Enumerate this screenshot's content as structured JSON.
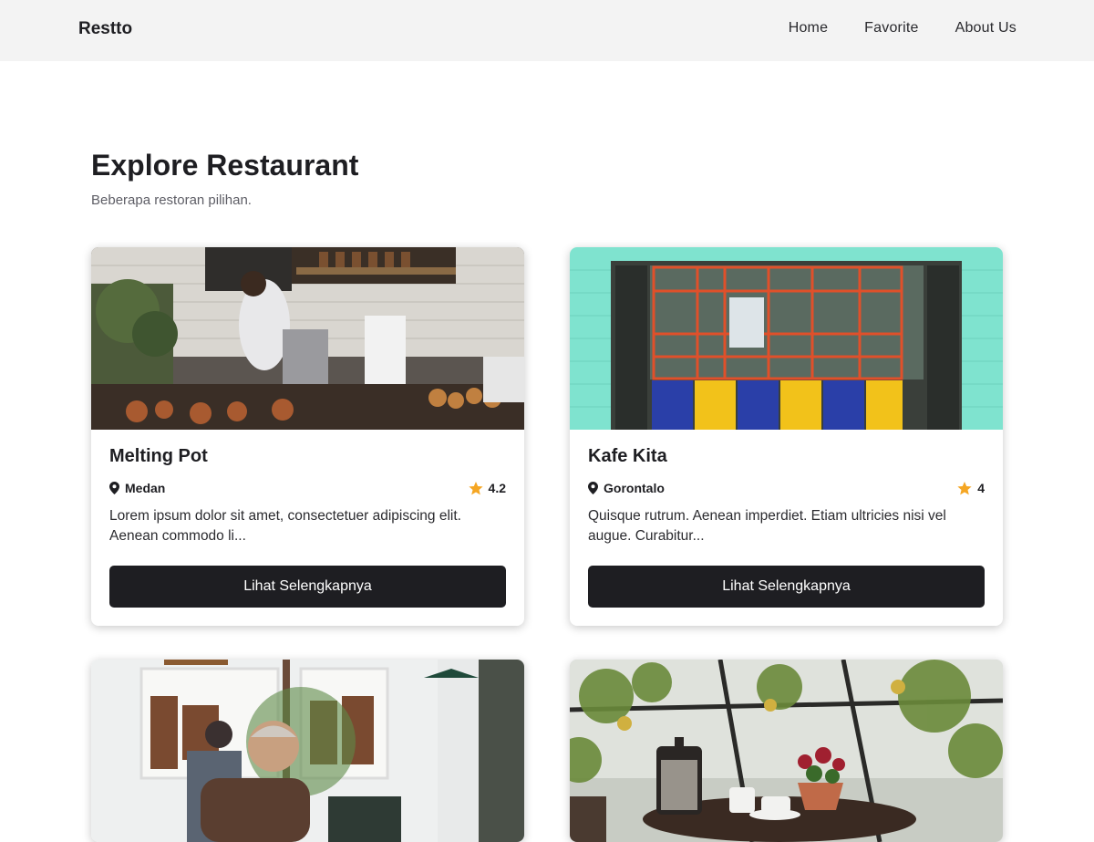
{
  "nav": {
    "brand": "Restto",
    "links": [
      "Home",
      "Favorite",
      "About Us"
    ]
  },
  "hero": {
    "title": "Explore Restaurant",
    "subtitle": "Beberapa restoran pilihan."
  },
  "colors": {
    "nav_bg": "#f3f3f3",
    "button_bg": "#1e1e22",
    "star": "#f5a623",
    "text": "#1e1e22"
  },
  "icons": {
    "location": "map-pin-icon",
    "rating": "star-icon"
  },
  "restaurants": [
    {
      "name": "Melting Pot",
      "city": "Medan",
      "rating": "4.2",
      "description": "Lorem ipsum dolor sit amet, consectetuer adipiscing elit. Aenean commodo li...",
      "button": "Lihat Selengkapnya"
    },
    {
      "name": "Kafe Kita",
      "city": "Gorontalo",
      "rating": "4",
      "description": "Quisque rutrum. Aenean imperdiet. Etiam ultricies nisi vel augue. Curabitur...",
      "button": "Lihat Selengkapnya"
    },
    {},
    {}
  ]
}
